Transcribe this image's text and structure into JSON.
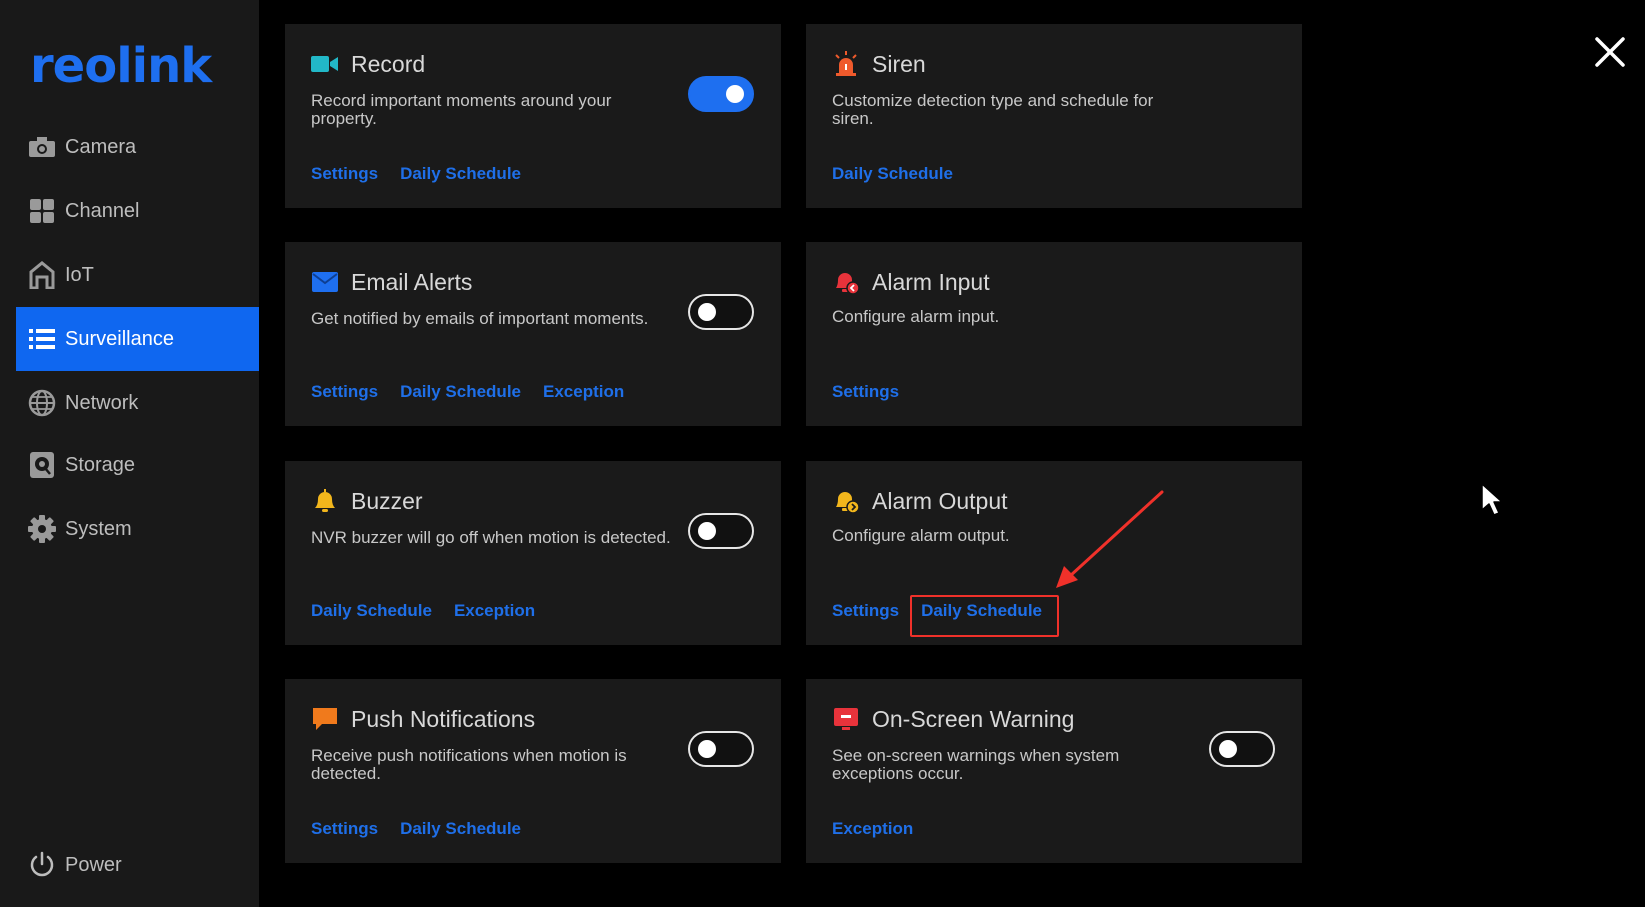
{
  "brand": {
    "logo_text": "reolink",
    "accent": "#1e6ff0"
  },
  "sidebar": {
    "items": [
      {
        "label": "Camera",
        "icon": "camera-icon"
      },
      {
        "label": "Channel",
        "icon": "grid-icon"
      },
      {
        "label": "IoT",
        "icon": "home-icon"
      },
      {
        "label": "Surveillance",
        "icon": "list-icon",
        "active": true
      },
      {
        "label": "Network",
        "icon": "globe-icon"
      },
      {
        "label": "Storage",
        "icon": "storage-icon"
      },
      {
        "label": "System",
        "icon": "gear-icon"
      }
    ],
    "power_label": "Power"
  },
  "cards": {
    "record": {
      "title": "Record",
      "desc": "Record important moments around your property.",
      "links": [
        "Settings",
        "Daily Schedule"
      ],
      "toggle": "on"
    },
    "siren": {
      "title": "Siren",
      "desc": "Customize detection type and schedule for siren.",
      "links": [
        "Daily Schedule"
      ]
    },
    "email": {
      "title": "Email Alerts",
      "desc": "Get notified by emails of important moments.",
      "links": [
        "Settings",
        "Daily Schedule",
        "Exception"
      ],
      "toggle": "off"
    },
    "alarm_input": {
      "title": "Alarm Input",
      "desc": "Configure alarm input.",
      "links": [
        "Settings"
      ]
    },
    "buzzer": {
      "title": "Buzzer",
      "desc": "NVR buzzer will go off when motion is detected.",
      "links": [
        "Daily Schedule",
        "Exception"
      ],
      "toggle": "off"
    },
    "alarm_output": {
      "title": "Alarm Output",
      "desc": "Configure alarm output.",
      "links": [
        "Settings",
        "Daily Schedule"
      ]
    },
    "push": {
      "title": "Push Notifications",
      "desc": "Receive push notifications when motion is detected.",
      "links": [
        "Settings",
        "Daily Schedule"
      ],
      "toggle": "off"
    },
    "warning": {
      "title": "On-Screen Warning",
      "desc": "See on-screen warnings when system exceptions occur.",
      "links": [
        "Exception"
      ],
      "toggle": "off"
    }
  },
  "annotation": {
    "color": "#f0312a",
    "highlighted": "Alarm Output › Daily Schedule"
  }
}
